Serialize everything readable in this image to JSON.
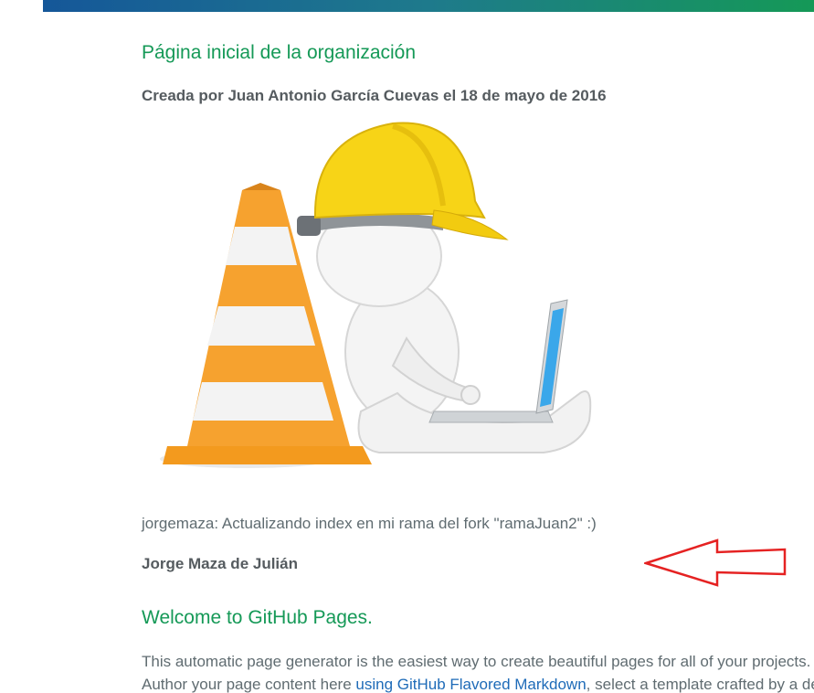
{
  "header": {
    "org_title": "Página inicial de la organización",
    "created_by": "Creada por Juan Antonio García Cuevas el 18 de mayo de 2016"
  },
  "illustration": {
    "description_icon": "construction-worker-laptop-icon"
  },
  "update": {
    "commit_message": "jorgemaza: Actualizando index en mi rama del fork \"ramaJuan2\" :)",
    "author": "Jorge Maza de Julián"
  },
  "welcome": {
    "title": "Welcome to GitHub Pages.",
    "line1": "This automatic page generator is the easiest way to create beautiful pages for all of your projects.",
    "line2_before": "Author your page content here ",
    "line2_link": "using GitHub Flavored Markdown",
    "line2_after": ", select a template crafted by a designer."
  },
  "colors": {
    "accent_green": "#159957",
    "link_blue": "#1e6bb8",
    "annotation_red": "#e52222"
  }
}
